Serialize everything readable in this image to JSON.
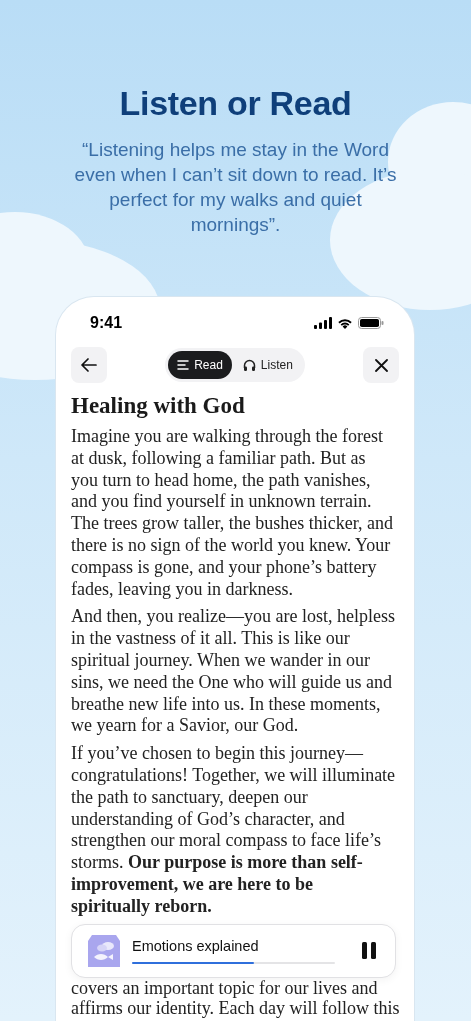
{
  "headline": "Listen or Read",
  "quote": "“Listening helps me stay in the Word even when I can’t sit down to read. It’s perfect for my walks and quiet mornings”.",
  "status_bar": {
    "time": "9:41"
  },
  "mode_tabs": [
    {
      "label": "Read",
      "selected": true
    },
    {
      "label": "Listen",
      "selected": false
    }
  ],
  "article": {
    "title": "Healing with God",
    "paragraphs": [
      "Imagine you are walking through the forest at dusk, following a familiar path. But as you turn to head home, the path vanishes, and you find yourself in unknown terrain. The trees grow taller, the bushes thicker, and there is no sign of the world you knew. Your compass is gone, and your phone’s battery fades, leaving you in darkness.",
      "And then, you realize—you are lost, helpless in the vastness of it all. This is like our spiritual journey. When we wander in our sins, we need the One who will guide us and breathe new life into us. In these moments, we yearn for a Savior, our God.",
      "If you’ve chosen to begin this journey—congratulations! Together, we will illuminate the path to sanctuary, deepen our understanding of God’s character, and strengthen our moral compass to face life’s storms. **Our purpose is more than self-improvement, we are here to be spiritually reborn.**"
    ],
    "continuation": "covers an important topic for our lives and affirms our identity. Each day will follow this"
  },
  "player": {
    "title": "Emotions explained",
    "level": 0.6,
    "playing": true
  }
}
